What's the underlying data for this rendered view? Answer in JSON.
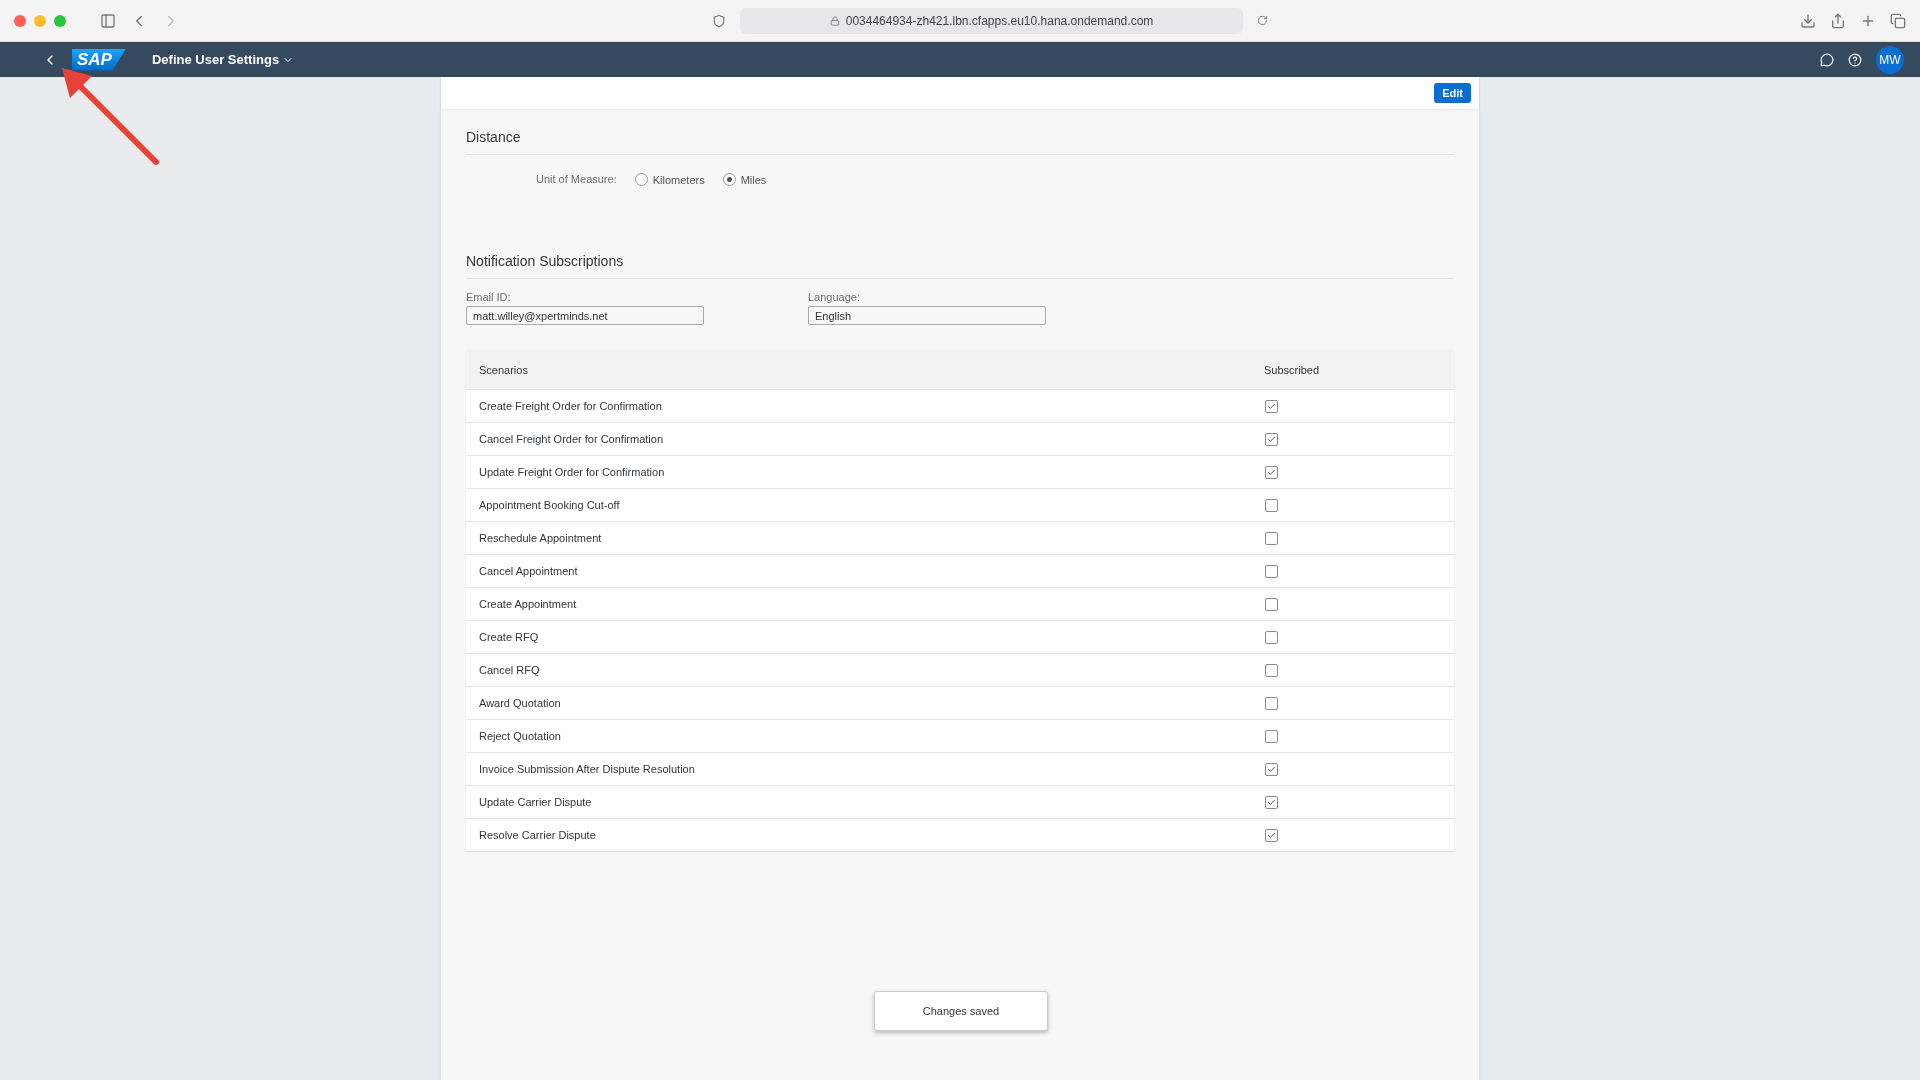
{
  "browser": {
    "url": "0034464934-zh421.lbn.cfapps.eu10.hana.ondemand.com"
  },
  "shell": {
    "logo": "SAP",
    "title": "Define User Settings",
    "avatar": "MW"
  },
  "toolbar": {
    "edit_button": "Edit"
  },
  "distance": {
    "title": "Distance",
    "label": "Unit of Measure:",
    "options": [
      {
        "label": "Kilometers",
        "selected": false
      },
      {
        "label": "Miles",
        "selected": true
      }
    ]
  },
  "notifications": {
    "title": "Notification Subscriptions",
    "email": {
      "label": "Email ID:",
      "value": "matt.willey@xpertminds.net"
    },
    "language": {
      "label": "Language:",
      "value": "English"
    },
    "table": {
      "columns": [
        "Scenarios",
        "Subscribed"
      ],
      "rows": [
        {
          "scenario": "Create Freight Order for Confirmation",
          "checked": true
        },
        {
          "scenario": "Cancel Freight Order for Confirmation",
          "checked": true
        },
        {
          "scenario": "Update Freight Order for Confirmation",
          "checked": true
        },
        {
          "scenario": "Appointment Booking Cut-off",
          "checked": false
        },
        {
          "scenario": "Reschedule Appointment",
          "checked": false
        },
        {
          "scenario": "Cancel Appointment",
          "checked": false
        },
        {
          "scenario": "Create Appointment",
          "checked": false
        },
        {
          "scenario": "Create RFQ",
          "checked": false
        },
        {
          "scenario": "Cancel RFQ",
          "checked": false
        },
        {
          "scenario": "Award Quotation",
          "checked": false
        },
        {
          "scenario": "Reject Quotation",
          "checked": false
        },
        {
          "scenario": "Invoice Submission After Dispute Resolution",
          "checked": true
        },
        {
          "scenario": "Update Carrier Dispute",
          "checked": true
        },
        {
          "scenario": "Resolve Carrier Dispute",
          "checked": true
        }
      ]
    }
  },
  "toast": "Changes saved"
}
